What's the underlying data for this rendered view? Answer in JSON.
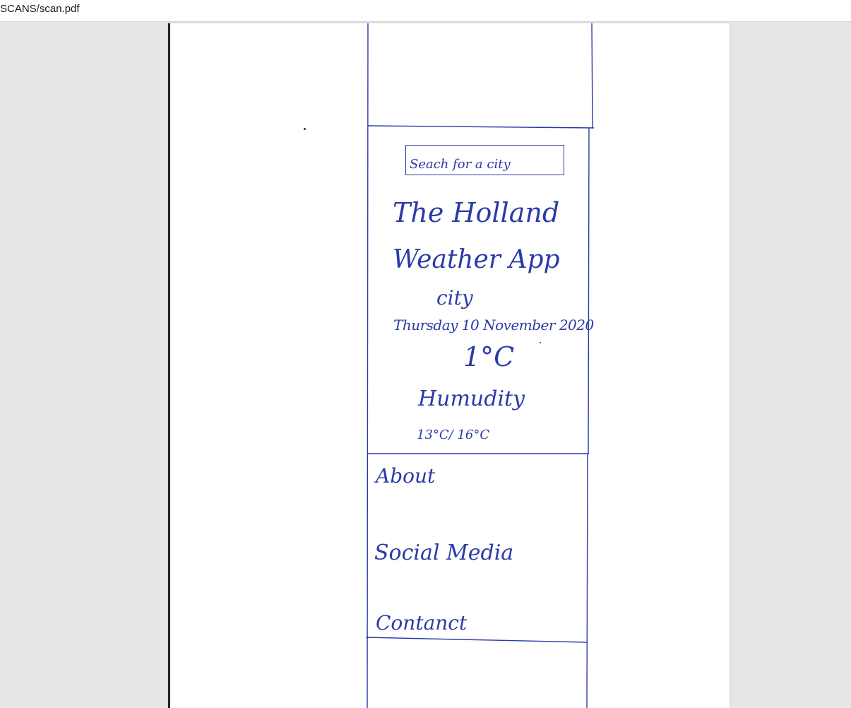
{
  "window": {
    "title": "SCANS/scan.pdf"
  },
  "colors": {
    "ink": "#2b3aa8",
    "viewer_bg": "#e6e6e6",
    "page_bg": "#ffffff"
  },
  "sketch": {
    "search_placeholder": "Seach for a city",
    "app_title_line1": "The Holland",
    "app_title_line2": "Weather App",
    "city": "city",
    "date": "Thursday 10 November 2020",
    "temperature": "1°C",
    "humidity_label": "Humudity",
    "min_max": "13°C/ 16°C",
    "nav": {
      "about": "About",
      "social_media": "Social Media",
      "contact": "Contanct"
    }
  }
}
